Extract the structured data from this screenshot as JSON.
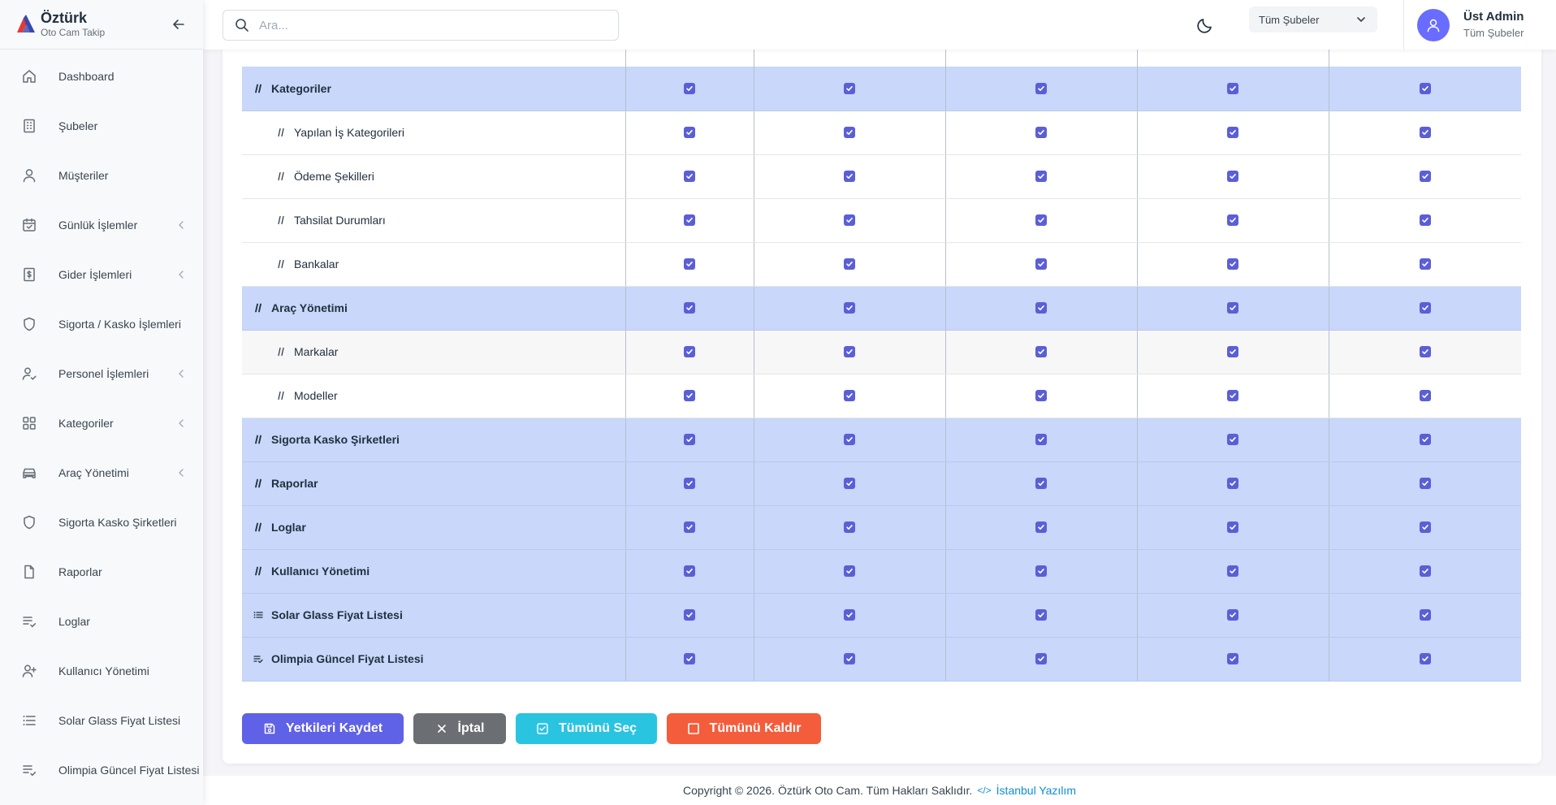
{
  "brand": {
    "name": "Öztürk",
    "subtitle": "Oto Cam Takip"
  },
  "sidebar": {
    "items": [
      {
        "label": "Dashboard",
        "icon": "home-icon",
        "has_submenu": false
      },
      {
        "label": "Şubeler",
        "icon": "building-icon",
        "has_submenu": false
      },
      {
        "label": "Müşteriler",
        "icon": "user-icon",
        "has_submenu": false
      },
      {
        "label": "Günlük İşlemler",
        "icon": "calendar-check-icon",
        "has_submenu": true
      },
      {
        "label": "Gider İşlemleri",
        "icon": "receipt-dollar-icon",
        "has_submenu": true
      },
      {
        "label": "Sigorta / Kasko İşlemleri",
        "icon": "shield-icon",
        "has_submenu": false
      },
      {
        "label": "Personel İşlemleri",
        "icon": "user-check-icon",
        "has_submenu": true
      },
      {
        "label": "Kategoriler",
        "icon": "grid-icon",
        "has_submenu": true
      },
      {
        "label": "Araç Yönetimi",
        "icon": "car-icon",
        "has_submenu": true
      },
      {
        "label": "Sigorta Kasko Şirketleri",
        "icon": "shield-icon",
        "has_submenu": false
      },
      {
        "label": "Raporlar",
        "icon": "file-icon",
        "has_submenu": false
      },
      {
        "label": "Loglar",
        "icon": "list-check-icon",
        "has_submenu": false
      },
      {
        "label": "Kullanıcı Yönetimi",
        "icon": "user-plus-icon",
        "has_submenu": false
      },
      {
        "label": "Solar Glass Fiyat Listesi",
        "icon": "list-icon",
        "has_submenu": false
      },
      {
        "label": "Olimpia Güncel Fiyat Listesi",
        "icon": "list-check-icon",
        "has_submenu": false
      }
    ]
  },
  "navbar": {
    "search_placeholder": "Ara...",
    "branch_select": "Tüm Şubeler",
    "user_name": "Üst Admin",
    "user_role": "Tüm Şubeler"
  },
  "permissions": {
    "rows": [
      {
        "name": "Kategoriler",
        "type": "group",
        "icon": "hash-icon",
        "checked": [
          true,
          true,
          true,
          true,
          true
        ]
      },
      {
        "name": "Yapılan İş Kategorileri",
        "type": "child",
        "icon": "hash-icon",
        "checked": [
          true,
          true,
          true,
          true,
          true
        ]
      },
      {
        "name": "Ödeme Şekilleri",
        "type": "child",
        "icon": "hash-icon",
        "checked": [
          true,
          true,
          true,
          true,
          true
        ]
      },
      {
        "name": "Tahsilat Durumları",
        "type": "child",
        "icon": "hash-icon",
        "checked": [
          true,
          true,
          true,
          true,
          true
        ]
      },
      {
        "name": "Bankalar",
        "type": "child",
        "icon": "hash-icon",
        "checked": [
          true,
          true,
          true,
          true,
          true
        ]
      },
      {
        "name": "Araç Yönetimi",
        "type": "group",
        "icon": "hash-icon",
        "checked": [
          true,
          true,
          true,
          true,
          true
        ]
      },
      {
        "name": "Markalar",
        "type": "child-alt",
        "icon": "hash-icon",
        "checked": [
          true,
          true,
          true,
          true,
          true
        ]
      },
      {
        "name": "Modeller",
        "type": "child",
        "icon": "hash-icon",
        "checked": [
          true,
          true,
          true,
          true,
          true
        ]
      },
      {
        "name": "Sigorta Kasko Şirketleri",
        "type": "group",
        "icon": "hash-icon",
        "checked": [
          true,
          true,
          true,
          true,
          true
        ]
      },
      {
        "name": "Raporlar",
        "type": "group",
        "icon": "hash-icon",
        "checked": [
          true,
          true,
          true,
          true,
          true
        ]
      },
      {
        "name": "Loglar",
        "type": "group",
        "icon": "hash-icon",
        "checked": [
          true,
          true,
          true,
          true,
          true
        ]
      },
      {
        "name": "Kullanıcı Yönetimi",
        "type": "group",
        "icon": "hash-icon",
        "checked": [
          true,
          true,
          true,
          true,
          true
        ]
      },
      {
        "name": "Solar Glass Fiyat Listesi",
        "type": "group",
        "icon": "list-icon",
        "checked": [
          true,
          true,
          true,
          true,
          true
        ]
      },
      {
        "name": "Olimpia Güncel Fiyat Listesi",
        "type": "group",
        "icon": "list-check-icon",
        "checked": [
          true,
          true,
          true,
          true,
          true
        ]
      }
    ]
  },
  "actions": {
    "save": "Yetkileri Kaydet",
    "cancel": "İptal",
    "select_all": "Tümünü Seç",
    "clear_all": "Tümünü Kaldır"
  },
  "footer": {
    "copyright": "Copyright © 2026. Öztürk Oto Cam. Tüm Hakları Saklıdır.",
    "link": "İstanbul Yazılım"
  },
  "colors": {
    "primary": "#5f61e6",
    "group_row": "#c8d7fa",
    "cancel": "#6b6f74",
    "info": "#29c4e0",
    "danger": "#f35d3c",
    "link": "#0d8fd4"
  }
}
